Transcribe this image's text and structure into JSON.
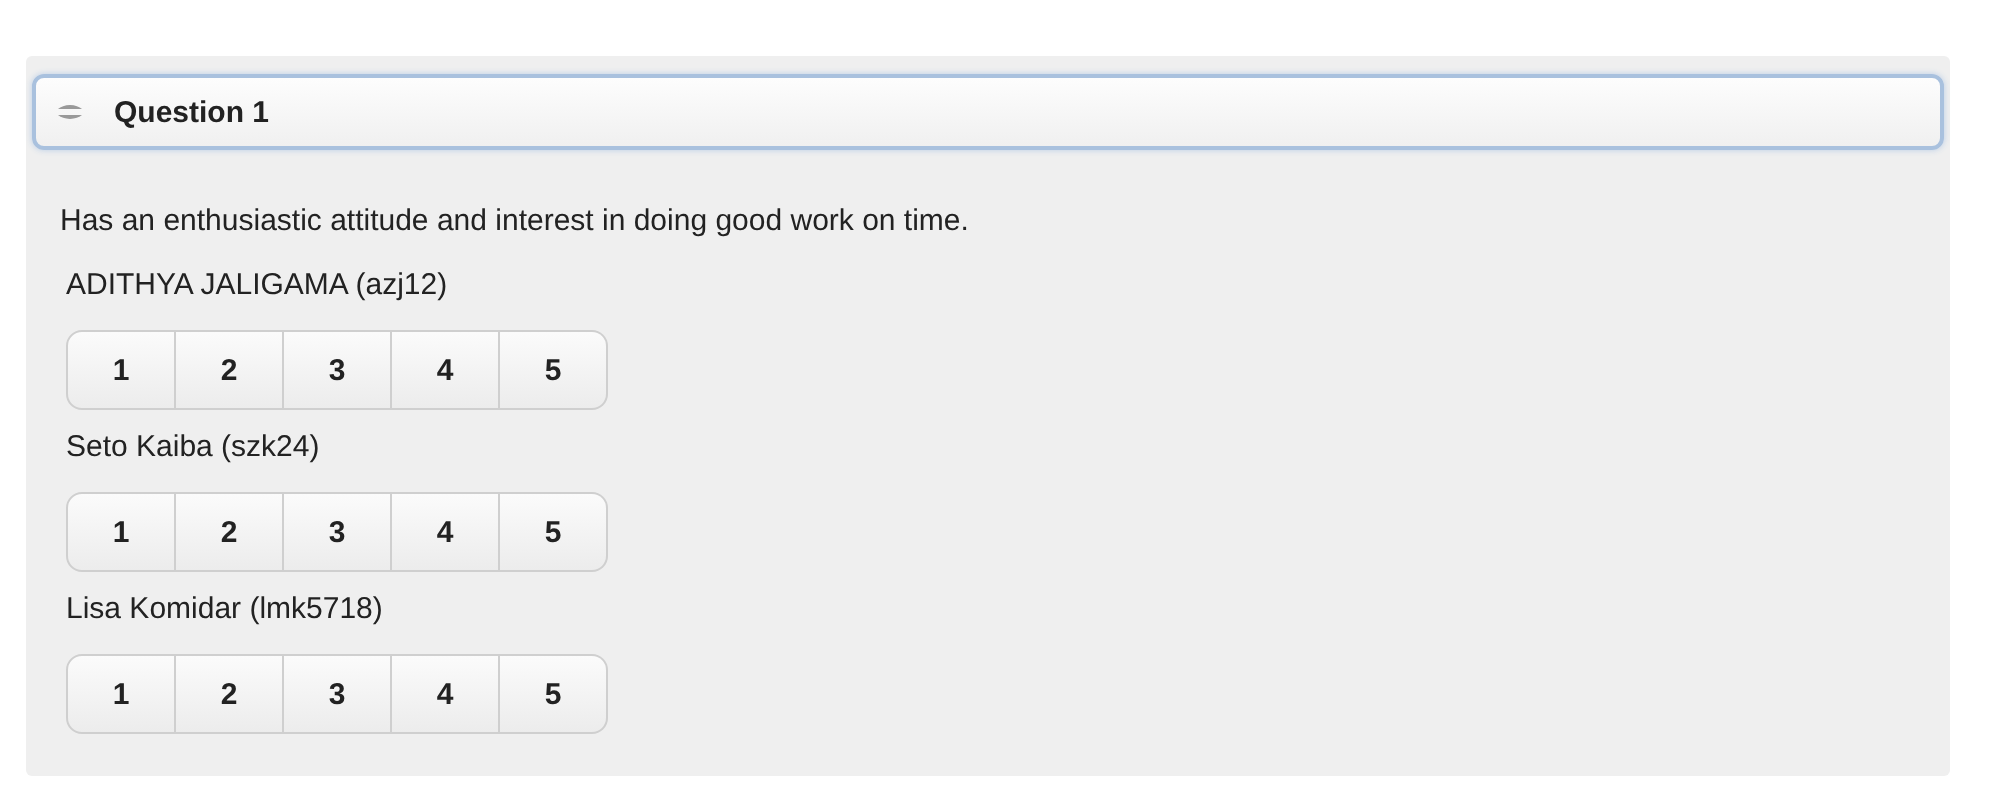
{
  "question": {
    "title": "Question 1",
    "expanded": true,
    "prompt": "Has an enthusiastic attitude and interest in doing good work on time.",
    "respondents": [
      {
        "name": "ADITHYA JALIGAMA (azj12)",
        "options": [
          {
            "label": "1",
            "selected": false
          },
          {
            "label": "2",
            "selected": false
          },
          {
            "label": "3",
            "selected": false
          },
          {
            "label": "4",
            "selected": false
          },
          {
            "label": "5",
            "selected": false
          }
        ]
      },
      {
        "name": "Seto Kaiba (szk24)",
        "options": [
          {
            "label": "1",
            "selected": false
          },
          {
            "label": "2",
            "selected": false
          },
          {
            "label": "3",
            "selected": false
          },
          {
            "label": "4",
            "selected": false
          },
          {
            "label": "5",
            "selected": false
          }
        ]
      },
      {
        "name": "Lisa Komidar (lmk5718)",
        "options": [
          {
            "label": "1",
            "selected": false
          },
          {
            "label": "2",
            "selected": false
          },
          {
            "label": "3",
            "selected": false
          },
          {
            "label": "4",
            "selected": false
          },
          {
            "label": "5",
            "selected": false
          }
        ]
      }
    ]
  }
}
